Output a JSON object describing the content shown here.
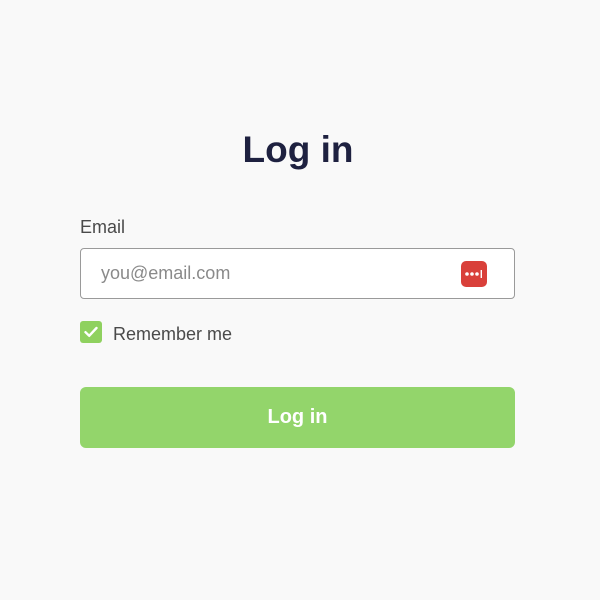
{
  "form": {
    "title": "Log in",
    "email_label": "Email",
    "email_value": "",
    "email_placeholder": "you@email.com",
    "password_manager_icon": "password-manager-dots-icon",
    "remember_label": "Remember me",
    "remember_checked": true,
    "submit_label": "Log in"
  },
  "colors": {
    "background": "#f9f9f9",
    "title": "#1e2140",
    "accent_green": "#93d56b",
    "checkbox_green": "#8fd15f",
    "password_manager_red": "#d9403a",
    "label_text": "#4a4a4a"
  }
}
